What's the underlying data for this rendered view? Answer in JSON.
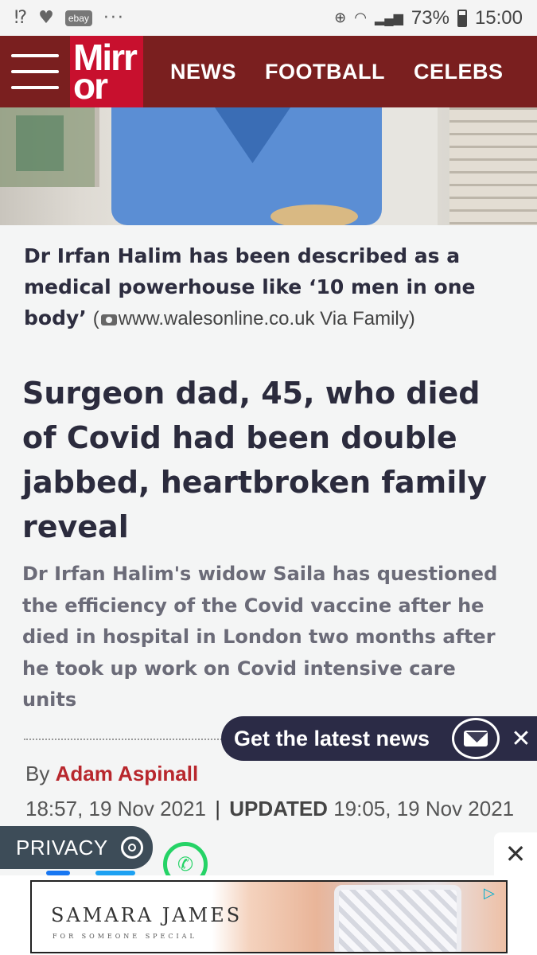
{
  "status_bar": {
    "left_icons": [
      "signal-alert-icon",
      "heart-icon",
      "ebay-icon"
    ],
    "ebay_label": "ebay",
    "more": "···",
    "battery": "73%",
    "time": "15:00"
  },
  "header": {
    "logo_line1": "Mirr",
    "logo_line2": "or",
    "nav": [
      "NEWS",
      "FOOTBALL",
      "CELEBS"
    ]
  },
  "caption": {
    "text": "Dr Irfan Halim has been described as a medical powerhouse like ‘10 men in one body’",
    "credit_open": "(",
    "credit": "www.walesonline.co.uk Via Family)"
  },
  "article": {
    "headline": "Surgeon dad, 45, who died of Covid had been double jabbed, heartbroken family reveal",
    "standfirst": "Dr Irfan Halim's widow Saila has questioned the efficiency of the Covid vaccine after he died in hospital in London two months after he took up work on Covid intensive care units",
    "byline_prefix": "By",
    "author": "Adam Aspinall",
    "published": "18:57, 19 Nov 2021",
    "separator": "|",
    "updated_label": "UPDATED",
    "updated": "19:05, 19 Nov 2021"
  },
  "newsletter": {
    "label": "Get the latest news",
    "close": "✕"
  },
  "privacy": {
    "label": "PRIVACY"
  },
  "ad": {
    "brand": "SAMARA JAMES",
    "tagline": "FOR SOMEONE SPECIAL",
    "close": "✕",
    "adchoice": "▷"
  }
}
